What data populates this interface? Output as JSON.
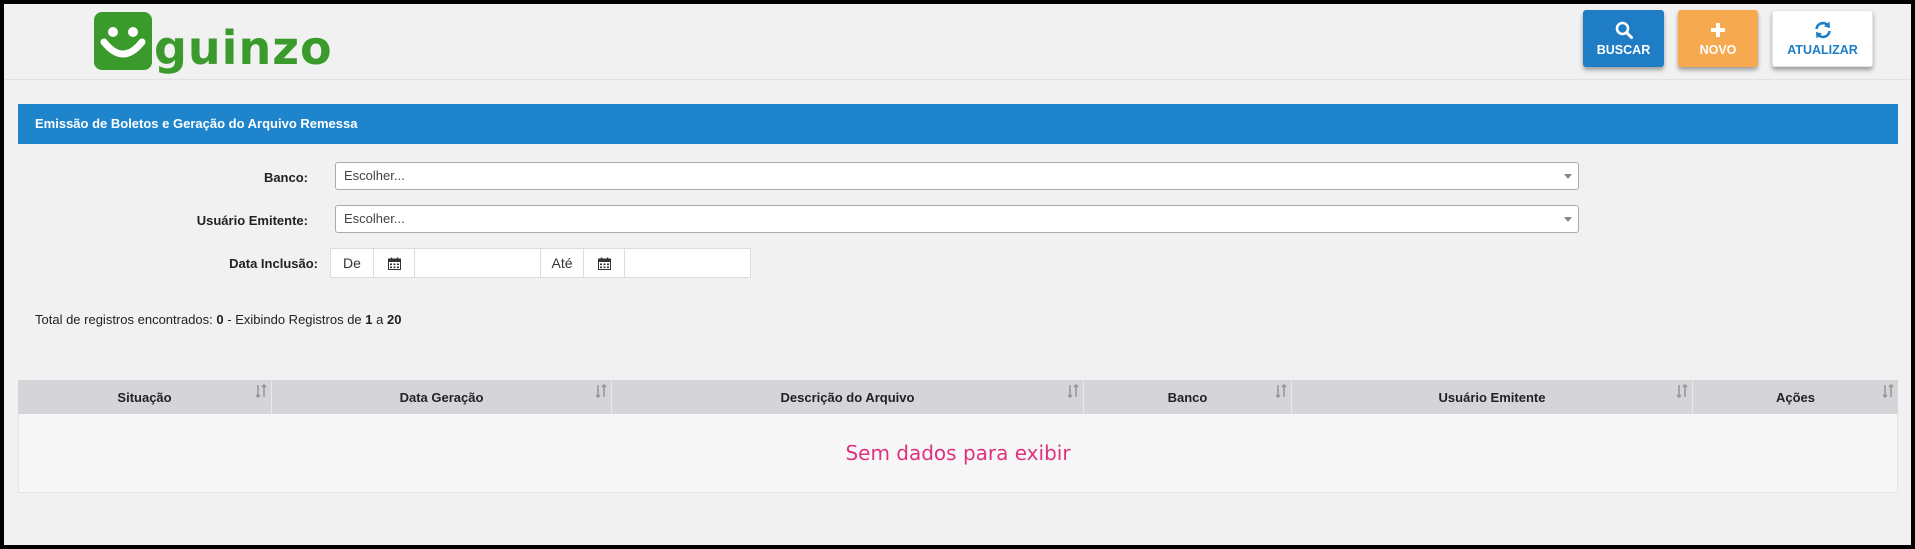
{
  "brand": {
    "name": "guinzo",
    "color": "#3a9a2c"
  },
  "header": {
    "buttons": [
      {
        "label": "BUSCAR",
        "icon": "search-icon",
        "color": "#1e7dc4"
      },
      {
        "label": "NOVO",
        "icon": "plus-icon",
        "color": "#f7a94f"
      },
      {
        "label": "ATUALIZAR",
        "icon": "refresh-icon",
        "color": "#ffffff"
      }
    ]
  },
  "panel": {
    "title": "Emissão de Boletos e Geração do Arquivo Remessa",
    "color": "#1e84cc"
  },
  "filters": {
    "banco": {
      "label": "Banco:",
      "value": "Escolher..."
    },
    "usuario": {
      "label": "Usuário Emitente:",
      "value": "Escolher..."
    },
    "data": {
      "label": "Data Inclusão:",
      "from_label": "De",
      "to_label": "Até",
      "from_value": "",
      "to_value": "",
      "icon": "calendar-icon"
    }
  },
  "totals": {
    "prefix": "Total de registros encontrados:",
    "count": "0",
    "middle": "- Exibindo Registros de",
    "start": "1",
    "sep": "a",
    "end": "20"
  },
  "table": {
    "columns": [
      "Situação",
      "Data Geração",
      "Descrição do Arquivo",
      "Banco",
      "Usuário Emitente",
      "Ações"
    ],
    "empty_message": "Sem dados para exibir",
    "empty_color": "#e0317f"
  }
}
